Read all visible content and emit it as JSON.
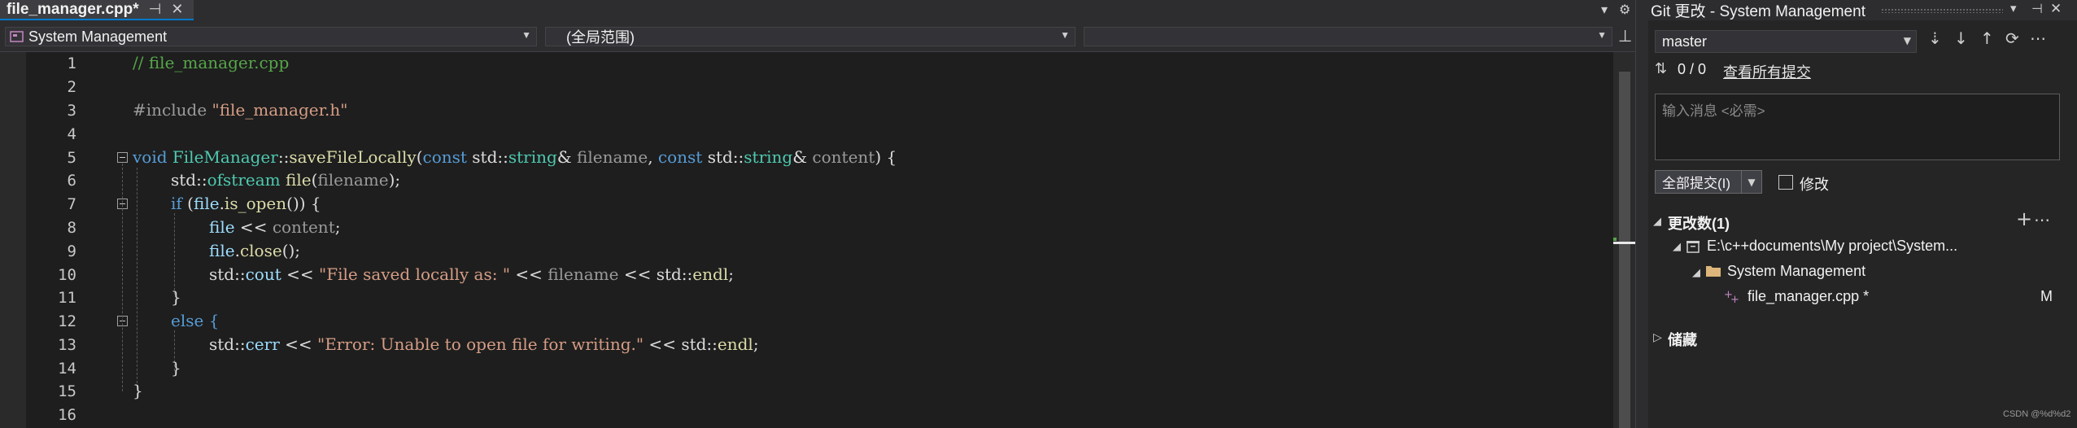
{
  "editor_tab": {
    "label": "file_manager.cpp*",
    "pin": "⊣",
    "close": "✕"
  },
  "tabstrip_icons": {
    "dropdown": "▾",
    "settings": "⚙"
  },
  "navbar": {
    "project": "System Management",
    "scope": "(全局范围)",
    "member": ""
  },
  "code": {
    "line_numbers": [
      "1",
      "2",
      "3",
      "4",
      "5",
      "6",
      "7",
      "8",
      "9",
      "10",
      "11",
      "12",
      "13",
      "14",
      "15",
      "16"
    ],
    "l1": "// file_manager.cpp",
    "l3a": "#include ",
    "l3b": "\"file_manager.h\"",
    "l5": {
      "kw_void": "void",
      "cls": "FileManager",
      "sep": "::",
      "fn": "saveFileLocally",
      "p1": "(",
      "kw_const1": "const",
      "ns1": " std::",
      "type1": "string",
      "amp1": "& ",
      "arg1": "filename",
      "comma": ", ",
      "kw_const2": "const",
      "ns2": " std::",
      "type2": "string",
      "amp2": "& ",
      "arg2": "content",
      "end": ") {"
    },
    "l6": {
      "ns": "std::",
      "type": "ofstream",
      "sp": " ",
      "var": "file",
      "rest_a": "(",
      "arg": "filename",
      "rest_b": ");"
    },
    "l7": {
      "kw": "if",
      "a": " (",
      "var": "file",
      "dot": ".",
      "fn": "is_open",
      "b": "()) {"
    },
    "l8": {
      "var": "file",
      "op": " << ",
      "arg": "content",
      "end": ";"
    },
    "l9": {
      "var": "file",
      "dot": ".",
      "fn": "close",
      "end": "();"
    },
    "l10": {
      "a": "std::",
      "b": "cout",
      "c": " << ",
      "str": "\"File saved locally as: \"",
      "d": " << ",
      "arg": "filename",
      "e": " << ",
      "f": "std::",
      "g": "endl",
      "h": ";"
    },
    "l11": "}",
    "l12": "else {",
    "l13": {
      "a": "std::",
      "b": "cerr",
      "c": " << ",
      "str": "\"Error: Unable to open file for writing.\"",
      "d": " << ",
      "f": "std::",
      "g": "endl",
      "h": ";"
    },
    "l14": "}",
    "l15": "}"
  },
  "git_panel": {
    "title": "Git 更改 - System Management",
    "title_icons": {
      "dropdown": "▾",
      "pin": "⊣",
      "close": "✕"
    },
    "branch": "master",
    "sync_icons": {
      "fetch": "⇣",
      "pull": "↓",
      "push": "↑",
      "sync": "⟳",
      "more": "⋯"
    },
    "commits_counter": "0 / 0",
    "view_all_commits": "查看所有提交",
    "commit_placeholder": "输入消息 <必需>",
    "commit_all_button": "全部提交(I)",
    "amend_label": "修改",
    "changes_header": "更改数(1)",
    "repo_path": "E:\\c++documents\\My project\\System...",
    "folder": "System Management",
    "changed_file": "file_manager.cpp *",
    "file_status": "M",
    "stashes_header": "储藏",
    "watermark": "CSDN @%d%d2"
  }
}
